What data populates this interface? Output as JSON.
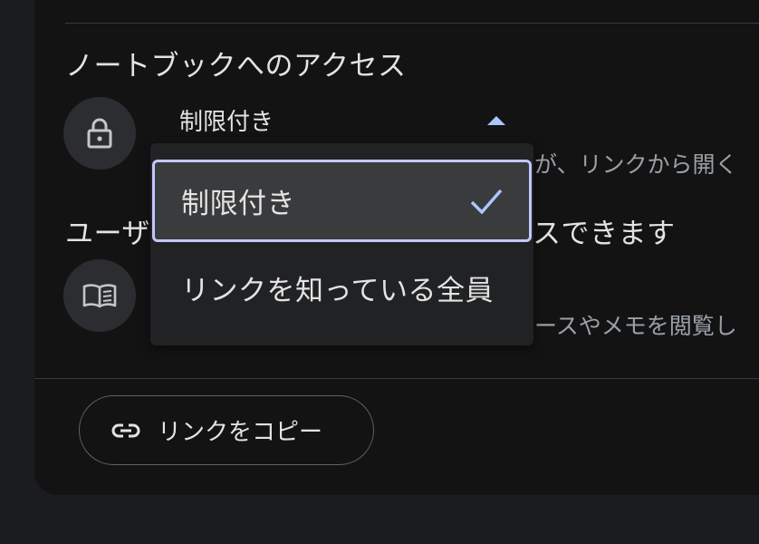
{
  "section": {
    "title": "ノートブックへのアクセス"
  },
  "access": {
    "current_value": "制限付き",
    "description_partial": "が、リンクから開く",
    "options": [
      {
        "label": "制限付き",
        "selected": true
      },
      {
        "label": "リンクを知っている全員",
        "selected": false
      }
    ]
  },
  "user_access": {
    "title_left": "ユーザ",
    "title_right": "スできます",
    "description_partial": "ースやメモを閲覧し"
  },
  "actions": {
    "copy_link_label": "リンクをコピー"
  },
  "icons": {
    "lock": "lock-icon",
    "book": "book-open-icon",
    "link": "link-icon",
    "check": "check-icon",
    "caret": "caret-up-icon"
  },
  "colors": {
    "accent": "#a8c7fa",
    "selected_border": "#c3c6ff",
    "background": "#131314",
    "dropdown_bg": "#212224",
    "selected_bg": "#3a3b3d"
  }
}
